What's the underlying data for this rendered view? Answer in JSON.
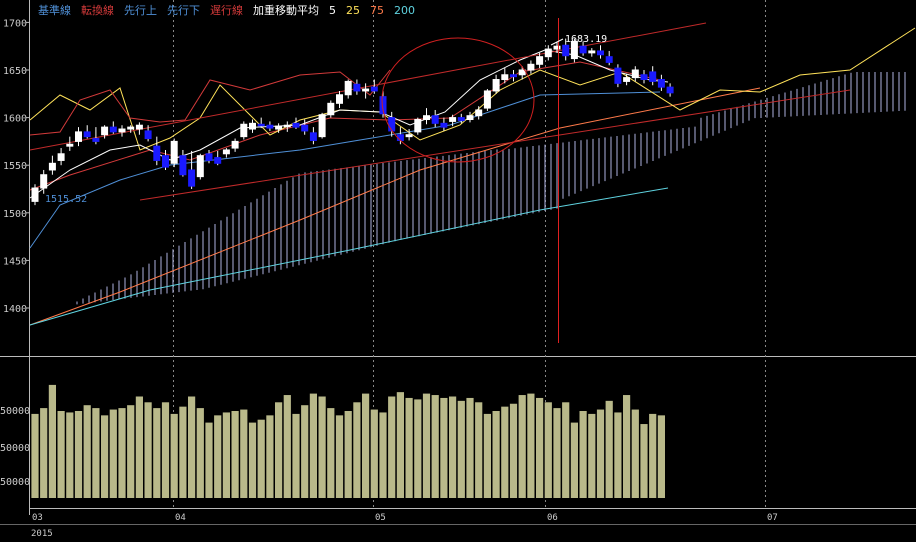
{
  "legend": [
    {
      "label": "基準線",
      "color": "#4f8fd6"
    },
    {
      "label": "転換線",
      "color": "#d23a3a"
    },
    {
      "label": "先行上",
      "color": "#4f8fd6"
    },
    {
      "label": "先行下",
      "color": "#4f8fd6"
    },
    {
      "label": "遅行線",
      "color": "#d23a3a"
    },
    {
      "label": "加重移動平均",
      "color": "#ffffff"
    },
    {
      "label": "5",
      "color": "#ffffff"
    },
    {
      "label": "25",
      "color": "#ffe25a"
    },
    {
      "label": "75",
      "color": "#ff7a4a"
    },
    {
      "label": "200",
      "color": "#5fd3e0"
    }
  ],
  "chart_data": [
    {
      "type": "candlestick",
      "yticks": [
        1400,
        1450,
        1500,
        1550,
        1600,
        1650,
        1700
      ],
      "ylim": [
        1365,
        1715
      ],
      "x_months": [
        "03",
        "04",
        "05",
        "06",
        "07"
      ],
      "x_year": "2015",
      "annotations": [
        {
          "text": "1515.52",
          "color": "#4f8fd6"
        },
        {
          "text": "1683.19",
          "color": "#ffffff"
        }
      ],
      "candles": [
        {
          "o": 1512,
          "h": 1530,
          "l": 1508,
          "c": 1526
        },
        {
          "o": 1526,
          "h": 1545,
          "l": 1520,
          "c": 1540
        },
        {
          "o": 1545,
          "h": 1560,
          "l": 1540,
          "c": 1552
        },
        {
          "o": 1555,
          "h": 1568,
          "l": 1550,
          "c": 1562
        },
        {
          "o": 1570,
          "h": 1580,
          "l": 1565,
          "c": 1572
        },
        {
          "o": 1575,
          "h": 1590,
          "l": 1570,
          "c": 1585
        },
        {
          "o": 1585,
          "h": 1592,
          "l": 1578,
          "c": 1580
        },
        {
          "o": 1578,
          "h": 1590,
          "l": 1572,
          "c": 1575
        },
        {
          "o": 1582,
          "h": 1592,
          "l": 1578,
          "c": 1590
        },
        {
          "o": 1590,
          "h": 1596,
          "l": 1583,
          "c": 1585
        },
        {
          "o": 1585,
          "h": 1592,
          "l": 1580,
          "c": 1588
        },
        {
          "o": 1588,
          "h": 1592,
          "l": 1584,
          "c": 1590
        },
        {
          "o": 1588,
          "h": 1595,
          "l": 1582,
          "c": 1592
        },
        {
          "o": 1586,
          "h": 1592,
          "l": 1575,
          "c": 1578
        },
        {
          "o": 1570,
          "h": 1580,
          "l": 1550,
          "c": 1555
        },
        {
          "o": 1560,
          "h": 1566,
          "l": 1545,
          "c": 1548
        },
        {
          "o": 1552,
          "h": 1578,
          "l": 1548,
          "c": 1575
        },
        {
          "o": 1560,
          "h": 1566,
          "l": 1538,
          "c": 1540
        },
        {
          "o": 1545,
          "h": 1565,
          "l": 1525,
          "c": 1528
        },
        {
          "o": 1538,
          "h": 1562,
          "l": 1535,
          "c": 1560
        },
        {
          "o": 1562,
          "h": 1566,
          "l": 1552,
          "c": 1555
        },
        {
          "o": 1558,
          "h": 1565,
          "l": 1550,
          "c": 1552
        },
        {
          "o": 1562,
          "h": 1568,
          "l": 1558,
          "c": 1566
        },
        {
          "o": 1568,
          "h": 1578,
          "l": 1564,
          "c": 1575
        },
        {
          "o": 1580,
          "h": 1596,
          "l": 1577,
          "c": 1593
        },
        {
          "o": 1588,
          "h": 1598,
          "l": 1584,
          "c": 1594
        },
        {
          "o": 1593,
          "h": 1600,
          "l": 1589,
          "c": 1592
        },
        {
          "o": 1592,
          "h": 1596,
          "l": 1586,
          "c": 1589
        },
        {
          "o": 1588,
          "h": 1594,
          "l": 1584,
          "c": 1591
        },
        {
          "o": 1591,
          "h": 1596,
          "l": 1585,
          "c": 1592
        },
        {
          "o": 1594,
          "h": 1600,
          "l": 1588,
          "c": 1590
        },
        {
          "o": 1592,
          "h": 1598,
          "l": 1582,
          "c": 1586
        },
        {
          "o": 1584,
          "h": 1590,
          "l": 1572,
          "c": 1576
        },
        {
          "o": 1580,
          "h": 1605,
          "l": 1578,
          "c": 1603
        },
        {
          "o": 1603,
          "h": 1618,
          "l": 1600,
          "c": 1615
        },
        {
          "o": 1615,
          "h": 1628,
          "l": 1610,
          "c": 1624
        },
        {
          "o": 1624,
          "h": 1640,
          "l": 1620,
          "c": 1638
        },
        {
          "o": 1635,
          "h": 1640,
          "l": 1624,
          "c": 1628
        },
        {
          "o": 1628,
          "h": 1636,
          "l": 1620,
          "c": 1630
        },
        {
          "o": 1632,
          "h": 1640,
          "l": 1625,
          "c": 1628
        },
        {
          "o": 1622,
          "h": 1628,
          "l": 1600,
          "c": 1604
        },
        {
          "o": 1600,
          "h": 1606,
          "l": 1580,
          "c": 1586
        },
        {
          "o": 1582,
          "h": 1590,
          "l": 1572,
          "c": 1576
        },
        {
          "o": 1580,
          "h": 1588,
          "l": 1576,
          "c": 1582
        },
        {
          "o": 1585,
          "h": 1600,
          "l": 1582,
          "c": 1598
        },
        {
          "o": 1598,
          "h": 1610,
          "l": 1593,
          "c": 1602
        },
        {
          "o": 1602,
          "h": 1608,
          "l": 1590,
          "c": 1594
        },
        {
          "o": 1594,
          "h": 1600,
          "l": 1586,
          "c": 1590
        },
        {
          "o": 1596,
          "h": 1603,
          "l": 1591,
          "c": 1600
        },
        {
          "o": 1600,
          "h": 1604,
          "l": 1594,
          "c": 1597
        },
        {
          "o": 1598,
          "h": 1606,
          "l": 1595,
          "c": 1602
        },
        {
          "o": 1602,
          "h": 1612,
          "l": 1598,
          "c": 1608
        },
        {
          "o": 1610,
          "h": 1630,
          "l": 1607,
          "c": 1628
        },
        {
          "o": 1628,
          "h": 1645,
          "l": 1625,
          "c": 1640
        },
        {
          "o": 1640,
          "h": 1652,
          "l": 1636,
          "c": 1645
        },
        {
          "o": 1645,
          "h": 1650,
          "l": 1638,
          "c": 1643
        },
        {
          "o": 1645,
          "h": 1654,
          "l": 1640,
          "c": 1650
        },
        {
          "o": 1650,
          "h": 1660,
          "l": 1646,
          "c": 1656
        },
        {
          "o": 1656,
          "h": 1668,
          "l": 1652,
          "c": 1664
        },
        {
          "o": 1664,
          "h": 1676,
          "l": 1660,
          "c": 1672
        },
        {
          "o": 1672,
          "h": 1680,
          "l": 1668,
          "c": 1675
        },
        {
          "o": 1676,
          "h": 1683,
          "l": 1660,
          "c": 1665
        },
        {
          "o": 1662,
          "h": 1683,
          "l": 1658,
          "c": 1680
        },
        {
          "o": 1675,
          "h": 1680,
          "l": 1665,
          "c": 1668
        },
        {
          "o": 1668,
          "h": 1673,
          "l": 1664,
          "c": 1670
        },
        {
          "o": 1670,
          "h": 1676,
          "l": 1662,
          "c": 1666
        },
        {
          "o": 1664,
          "h": 1670,
          "l": 1655,
          "c": 1658
        },
        {
          "o": 1652,
          "h": 1656,
          "l": 1632,
          "c": 1636
        },
        {
          "o": 1638,
          "h": 1646,
          "l": 1634,
          "c": 1642
        },
        {
          "o": 1642,
          "h": 1654,
          "l": 1638,
          "c": 1650
        },
        {
          "o": 1645,
          "h": 1650,
          "l": 1636,
          "c": 1640
        },
        {
          "o": 1648,
          "h": 1654,
          "l": 1634,
          "c": 1638
        },
        {
          "o": 1640,
          "h": 1645,
          "l": 1628,
          "c": 1632
        },
        {
          "o": 1632,
          "h": 1636,
          "l": 1622,
          "c": 1626
        }
      ]
    },
    {
      "type": "bar",
      "ytick_labels": [
        "50000",
        "50000",
        "50000"
      ],
      "volumes": [
        58,
        62,
        78,
        60,
        59,
        60,
        64,
        62,
        57,
        61,
        62,
        64,
        70,
        66,
        62,
        66,
        58,
        63,
        70,
        62,
        52,
        57,
        59,
        60,
        61,
        52,
        54,
        57,
        66,
        71,
        58,
        64,
        72,
        70,
        62,
        57,
        60,
        66,
        72,
        61,
        59,
        70,
        73,
        69,
        68,
        72,
        71,
        69,
        70,
        67,
        69,
        66,
        58,
        60,
        63,
        65,
        71,
        72,
        69,
        66,
        62,
        66,
        52,
        60,
        58,
        61,
        67,
        59,
        71,
        61,
        51,
        58,
        57
      ]
    }
  ]
}
